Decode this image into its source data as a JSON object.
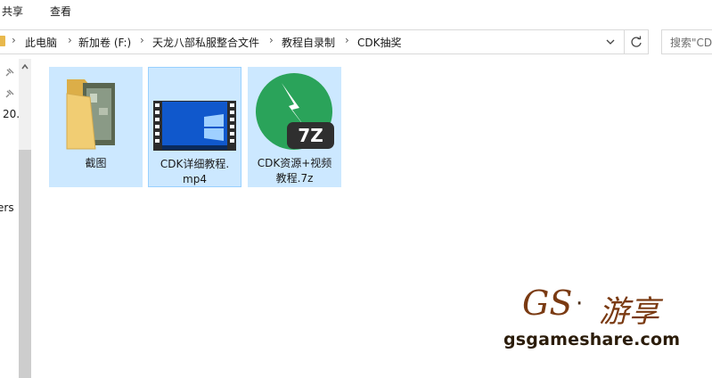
{
  "ribbon": {
    "tabs": [
      "共享",
      "查看"
    ]
  },
  "breadcrumb": [
    "此电脑",
    "新加卷 (F:)",
    "天龙八部私服整合文件",
    "教程自录制",
    "CDK抽奖"
  ],
  "search": {
    "placeholder": "搜索\"CD"
  },
  "nav": {
    "label_top": "20.",
    "label_mid": "ers"
  },
  "files": [
    {
      "name": "截图",
      "type": "folder"
    },
    {
      "name": "CDK详细教程.mp4",
      "line1": "CDK详细教程.",
      "line2": "mp4",
      "type": "video"
    },
    {
      "name": "CDK资源+视频教程.7z",
      "line1": "CDK资源+视频",
      "line2": "教程.7z",
      "type": "7z",
      "badge": "7Z"
    }
  ],
  "watermark": {
    "brand": "GS",
    "dot": "·",
    "cn": "游享",
    "url": "gsgameshare.com"
  },
  "colors": {
    "selection": "#cce8ff",
    "selection_border": "#99d1ff",
    "sevenzip": "#2aa35a",
    "folder": "#e8b84c"
  }
}
